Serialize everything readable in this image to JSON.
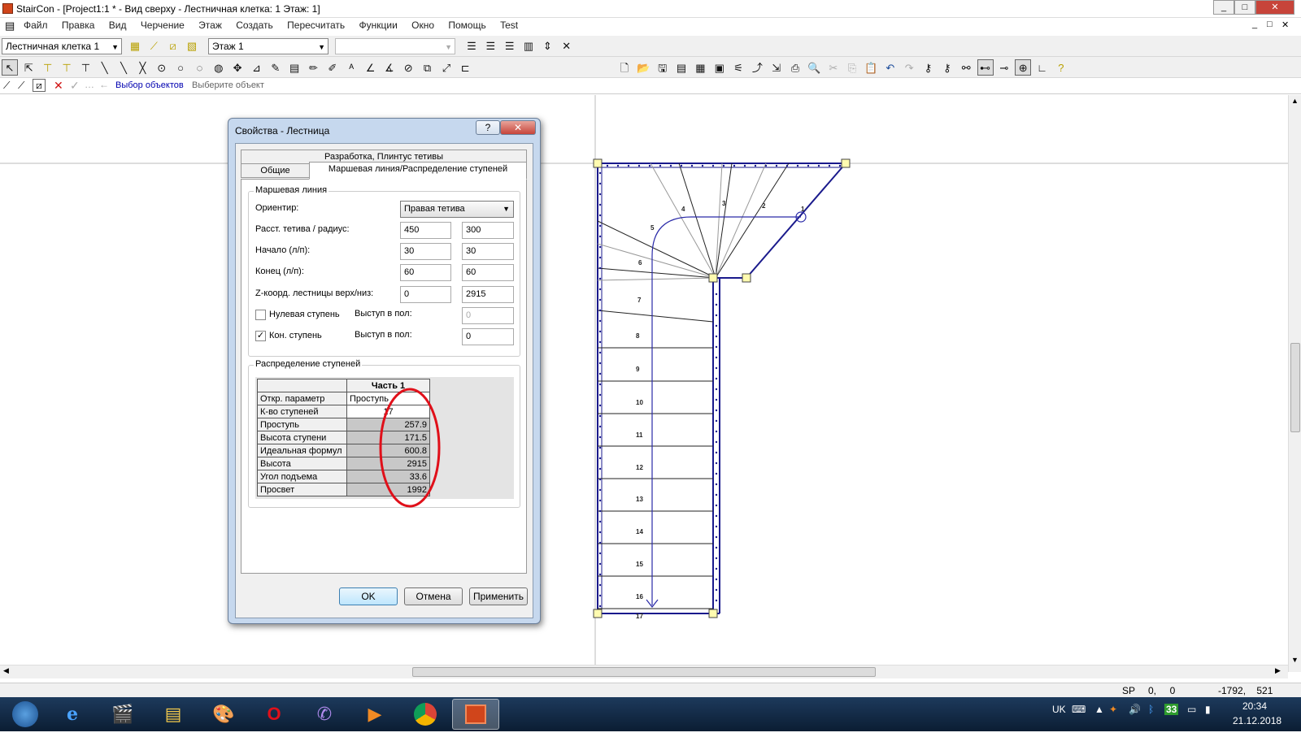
{
  "window": {
    "title": "StairCon - [Project1:1 * - Вид сверху - Лестничная клетка: 1 Этаж: 1]",
    "controls": [
      "_",
      "□",
      "✕"
    ],
    "doc_controls": [
      "_",
      "□",
      "✕"
    ]
  },
  "menu": [
    "Файл",
    "Правка",
    "Вид",
    "Черчение",
    "Этаж",
    "Создать",
    "Пересчитать",
    "Функции",
    "Окно",
    "Помощь",
    "Test"
  ],
  "toolbar": {
    "stairwell_select": "Лестничная клетка 1",
    "floor_select": "Этаж 1",
    "empty_select": ""
  },
  "command_bar": {
    "mode": "Выбор объектов",
    "prompt": "Выберите объект"
  },
  "dialog": {
    "title": "Свойства - Лестница",
    "help_btn": "?",
    "close_btn": "✕",
    "tabs_row1": [
      "Разработка, Плинтус тетивы"
    ],
    "tabs_row2": [
      "Общие",
      "Маршевая линия/Распределение ступеней"
    ],
    "group1_title": "Маршевая линия",
    "orient_label": "Ориентир:",
    "orient_value": "Правая тетива",
    "rows": [
      {
        "label": "Расст. тетива / радиус:",
        "v1": "450",
        "v2": "300"
      },
      {
        "label": "Начало (л/п):",
        "v1": "30",
        "v2": "30"
      },
      {
        "label": "Конец (л/п):",
        "v1": "60",
        "v2": "60"
      },
      {
        "label": "Z-коорд. лестницы верх/низ:",
        "v1": "0",
        "v2": "2915"
      }
    ],
    "zero_step": {
      "label": "Нулевая ступень",
      "checked": false,
      "overhang_label": "Выступ в пол:",
      "overhang_value": "0"
    },
    "end_step": {
      "label": "Кон. ступень",
      "checked": true,
      "overhang_label": "Выступ в пол:",
      "overhang_value": "0"
    },
    "group2_title": "Распределение ступеней",
    "table_header": "Часть 1",
    "table_rows": [
      {
        "name": "Откр. параметр",
        "value": "Проступь"
      },
      {
        "name": "К-во ступеней",
        "value": "17"
      },
      {
        "name": "Проступь",
        "value": "257.9"
      },
      {
        "name": "Высота ступени",
        "value": "171.5"
      },
      {
        "name": "Идеальная формул",
        "value": "600.8"
      },
      {
        "name": "Высота",
        "value": "2915"
      },
      {
        "name": "Угол подъема",
        "value": "33.6"
      },
      {
        "name": "Просвет",
        "value": "1992"
      }
    ],
    "buttons": {
      "ok": "OK",
      "cancel": "Отмена",
      "apply": "Применить"
    }
  },
  "drawing": {
    "step_numbers": [
      "1",
      "2",
      "3",
      "4",
      "5",
      "6",
      "7",
      "8",
      "9",
      "10",
      "11",
      "12",
      "13",
      "14",
      "15",
      "16",
      "17"
    ],
    "line_color": "#1a1a8c",
    "handle_color": "#fffbb0"
  },
  "status": {
    "mode": "SP",
    "coords1": "0,     0",
    "coords2": "-1792,    521"
  },
  "taskbar": {
    "apps": [
      "start-orb",
      "ie",
      "media-pro",
      "explorer",
      "paint",
      "opera",
      "viber",
      "video",
      "chrome",
      "staircon"
    ],
    "lang": "UK",
    "tray_badge": "33",
    "time": "20:34",
    "date": "21.12.2018"
  },
  "accent": {
    "annotation": "#e0101a",
    "selection_blue": "#3399ff"
  }
}
